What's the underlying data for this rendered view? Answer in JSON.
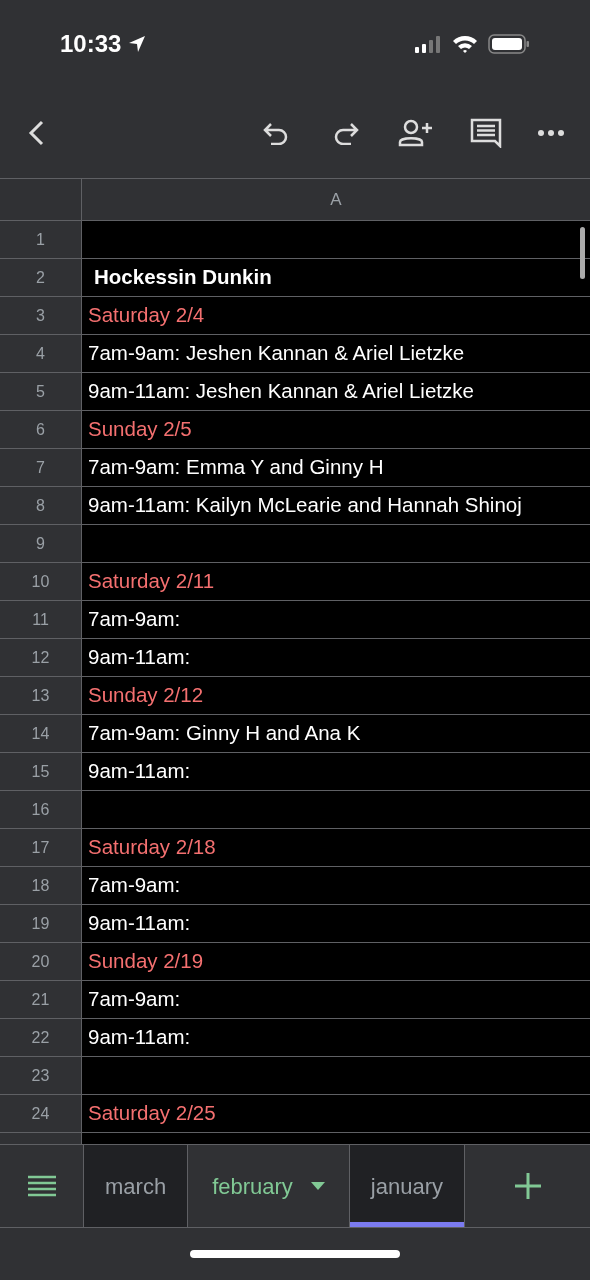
{
  "status_bar": {
    "time": "10:33"
  },
  "sheet": {
    "column_header": "A",
    "rows": [
      {
        "number": "1"
      },
      {
        "number": "2",
        "kind": "title",
        "text": "Hockessin Dunkin"
      },
      {
        "number": "3",
        "kind": "date",
        "text": "Saturday 2/4"
      },
      {
        "number": "4",
        "kind": "slot",
        "text": "7am-9am: Jeshen Kannan & Ariel Lietzke"
      },
      {
        "number": "5",
        "kind": "slot",
        "text": "9am-11am: Jeshen Kannan & Ariel Lietzke"
      },
      {
        "number": "6",
        "kind": "date",
        "text": "Sunday 2/5"
      },
      {
        "number": "7",
        "kind": "slot",
        "text": "7am-9am: Emma Y and Ginny H"
      },
      {
        "number": "8",
        "kind": "slot",
        "text": "9am-11am: Kailyn McLearie and Hannah Shinoj"
      },
      {
        "number": "9"
      },
      {
        "number": "10",
        "kind": "date",
        "text": "Saturday 2/11"
      },
      {
        "number": "11",
        "kind": "slot",
        "text": "7am-9am:"
      },
      {
        "number": "12",
        "kind": "slot",
        "text": "9am-11am:"
      },
      {
        "number": "13",
        "kind": "date",
        "text": "Sunday 2/12"
      },
      {
        "number": "14",
        "kind": "slot",
        "text": "7am-9am:  Ginny H and Ana K"
      },
      {
        "number": "15",
        "kind": "slot",
        "text": "9am-11am:"
      },
      {
        "number": "16"
      },
      {
        "number": "17",
        "kind": "date",
        "text": "Saturday 2/18"
      },
      {
        "number": "18",
        "kind": "slot",
        "text": "7am-9am:"
      },
      {
        "number": "19",
        "kind": "slot",
        "text": "9am-11am:"
      },
      {
        "number": "20",
        "kind": "date",
        "text": "Sunday 2/19"
      },
      {
        "number": "21",
        "kind": "slot",
        "text": "7am-9am:"
      },
      {
        "number": "22",
        "kind": "slot",
        "text": "9am-11am:"
      },
      {
        "number": "23"
      },
      {
        "number": "24",
        "kind": "date",
        "text": "Saturday 2/25"
      }
    ]
  },
  "sheet_tabs": [
    {
      "label": "march",
      "selected": false
    },
    {
      "label": "february",
      "selected": true
    },
    {
      "label": "january",
      "selected": false,
      "color": "#7b7bf0"
    }
  ]
}
